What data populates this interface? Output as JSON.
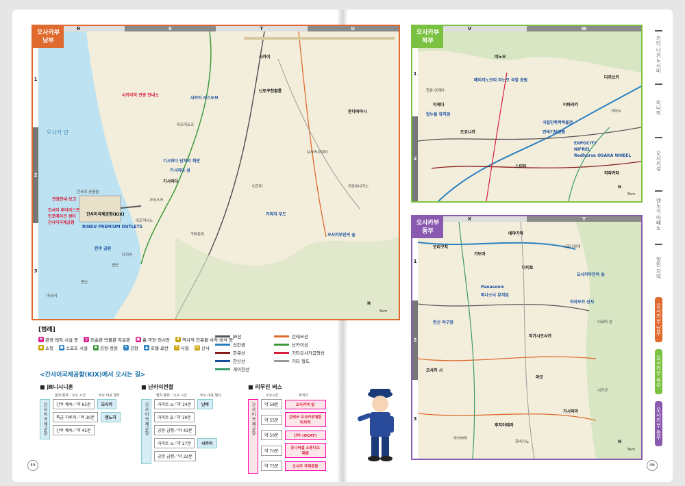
{
  "south_map": {
    "tag_line1": "오사카부",
    "tag_line2": "남부",
    "columns": [
      "R",
      "S",
      "T",
      "U"
    ],
    "rows": [
      "1",
      "2",
      "3"
    ],
    "labels": {
      "airport_sign": "사카이역 관광 안내소",
      "tourist_info": "관광안내·보고",
      "kix_info1": "간사이 투어리스트",
      "kix_info2": "인포메이션 센터",
      "kix_info3": "간사이국제공항",
      "kix": "간사이국제공항(KIX)",
      "outlets": "RINKU PREMIUM OUTLETS",
      "rinku_park": "린쿠 공원",
      "sakai_tower": "사카이 리스도모",
      "nintoku": "닌토쿠천황릉",
      "ozu": "이즈미오즈",
      "kishiwada": "기시와다",
      "izumisano": "이즈미사노",
      "kaizuka": "가이즈카",
      "sennan": "센난",
      "hannan": "한난",
      "misaki": "미사키",
      "sakai": "사카이",
      "tondabayashi": "돈다바야시",
      "kawachinagano": "가와치나가노",
      "izumi": "이즈미",
      "kishiwada_castle": "기시와다 성",
      "danjiri": "기시와다 단지리 회관",
      "kumatori": "구마토리",
      "tajiri": "다지리",
      "airport_island": "간사이 공항섬",
      "bay": "오사카 만",
      "wood": "가와치 우드",
      "farm": "오사카부민의 숲",
      "sayama": "오사카사야마"
    },
    "scale": "5km",
    "compass": "N"
  },
  "north_map": {
    "tag_line1": "오사카부",
    "tag_line2": "북부",
    "columns": [
      "V",
      "W"
    ],
    "rows": [
      "1",
      "2"
    ],
    "labels": {
      "expo": "만박기념공원",
      "expocity": "EXPOCITY",
      "nifrel": "NIFREL",
      "redhorse": "Redhorse OSAKA WHEEL",
      "takatsuki": "다카쓰키",
      "ibaraki": "이바라키",
      "toyonaka": "도요나카",
      "minoh": "미노오",
      "suita": "스이타",
      "ikeda": "이케다",
      "hirakata": "히라카타",
      "katano": "가타노",
      "cupnoodles": "컵누들 뮤지엄",
      "minoh_park": "메이지노모리 미노오 국정 공원",
      "hankyu": "한큐 이케다",
      "kokuritsu": "국립민족학박물관"
    },
    "scale": "5km",
    "compass": "N"
  },
  "east_map": {
    "tag_line1": "오사카부",
    "tag_line2": "동부",
    "columns": [
      "X",
      "Y"
    ],
    "rows": [
      "1",
      "2",
      "3"
    ],
    "labels": {
      "panasonic": "Panasonic",
      "mizuo": "파나소닉 뮤지엄",
      "hiraoka": "히라오카 신사",
      "higashiosaka": "히가시오사카",
      "yao": "야오",
      "kashiwara": "가시와라",
      "fujiidera": "후지이데라",
      "habikino": "하비키노",
      "daito": "다이토",
      "kadoma": "가도마",
      "moriguchi": "모리구치",
      "neyagawa": "네야가와",
      "shijonawate": "시조나와테",
      "ikoma": "이코마 산",
      "shigisan": "시기산",
      "dome": "한신 야구장",
      "forest": "오사카부민의 숲",
      "osaka_city": "오사카 시",
      "matsubara": "마쓰바라"
    },
    "scale": "5km",
    "compass": "N"
  },
  "legend": {
    "title": "[범례]",
    "icons": [
      {
        "label": "관광·레저 시설 등",
        "color": "#d81e8c",
        "glyph": "★"
      },
      {
        "label": "미술관·박물관·자료관",
        "color": "#d81e8c",
        "glyph": "◎"
      },
      {
        "label": "홀·극장·전시장",
        "color": "#d81e8c",
        "glyph": "▣"
      },
      {
        "label": "역사적 건축물·사적·비석 등",
        "color": "#c9a000",
        "glyph": "♜"
      },
      {
        "label": "쇼핑",
        "color": "#c9a000",
        "glyph": "◆"
      },
      {
        "label": "스포츠 시설",
        "color": "#2a7fc0",
        "glyph": "●"
      },
      {
        "label": "공원·정원",
        "color": "#3a9a3a",
        "glyph": "♣"
      },
      {
        "label": "공항",
        "color": "#2a7fc0",
        "glyph": "✈"
      },
      {
        "label": "호텔·료칸",
        "color": "#2a7fc0",
        "glyph": "▲"
      },
      {
        "label": "사찰",
        "color": "#c9a000",
        "glyph": "卍"
      },
      {
        "label": "신사",
        "color": "#c9a000",
        "glyph": "⛩"
      }
    ],
    "lines": [
      {
        "label": "JR선",
        "color": "#555555"
      },
      {
        "label": "긴테쓰선",
        "color": "#e06a2e"
      },
      {
        "label": "신칸센",
        "color": "#2a7fc0"
      },
      {
        "label": "난카이선",
        "color": "#3a9a3a"
      },
      {
        "label": "한큐선",
        "color": "#8b1a1a"
      },
      {
        "label": "기타오사카급행선",
        "color": "#d81e3c"
      },
      {
        "label": "한신선",
        "color": "#1a4fa0"
      },
      {
        "label": "기타 철도",
        "color": "#999999"
      },
      {
        "label": "게이한선",
        "color": "#3a9a6a"
      }
    ]
  },
  "kix_access": {
    "title": "<간사이국제공항(KIX)에서 오시는 길>",
    "jr": {
      "title": "■ JR니시니혼",
      "head_type": "열차 종류／소요 시간",
      "head_station": "주요 대표 열차",
      "vlabel": "간사이국제공항",
      "routes": [
        {
          "train": "간쿠 쾌속",
          "time": "약 65분",
          "dest": "오사카"
        },
        {
          "train": "특급 하루카",
          "time": "약 30분",
          "dest": "덴노지"
        },
        {
          "train": "간쿠 쾌속",
          "time": "약 45분",
          "dest": ""
        }
      ]
    },
    "nankai": {
      "title": "■ 난카이전철",
      "head_type": "열차 종류／소요 시간",
      "head_station": "주요 대표 열차",
      "vlabel": "간사이국제공항",
      "routes": [
        {
          "train": "라피트 α",
          "time": "약 34분",
          "dest": "난바"
        },
        {
          "train": "라피트 β",
          "time": "약 39분",
          "dest": ""
        },
        {
          "train": "공항 급행",
          "time": "약 43분",
          "dest": ""
        },
        {
          "train": "라피트 α",
          "time": "약 27분",
          "dest": "사카이"
        },
        {
          "train": "공항 급행",
          "time": "약 32분",
          "dest": ""
        }
      ]
    },
    "bus": {
      "title": "■ 리무진 버스",
      "head_time": "소요시간",
      "head_dest": "목적지",
      "vlabel": "간사이국제공항",
      "routes": [
        {
          "time": "약 58분",
          "dest": "오사카역 앞"
        },
        {
          "time": "약 55분",
          "dest": "긴테쓰 오사카우에혼마치역"
        },
        {
          "time": "약 50분",
          "dest": "난바 (OCAT)"
        },
        {
          "time": "약 70분",
          "dest": "유니버설 스튜디오 재팬"
        },
        {
          "time": "약 75분",
          "dest": "오사카 국제공항"
        }
      ]
    }
  },
  "page_numbers": {
    "left": "45",
    "right": "46"
  },
  "side_tabs": [
    {
      "label": "키타·나카노시마",
      "state": "normal"
    },
    {
      "label": "미나미",
      "state": "normal"
    },
    {
      "label": "오사카성",
      "state": "normal"
    },
    {
      "label": "덴노지·아베노",
      "state": "normal"
    },
    {
      "label": "항만 지역",
      "state": "normal"
    },
    {
      "label": "오사카부 남부",
      "state": "active1"
    },
    {
      "label": "오사카부 북부",
      "state": "active2"
    },
    {
      "label": "오사카부 동부",
      "state": "active3"
    }
  ]
}
